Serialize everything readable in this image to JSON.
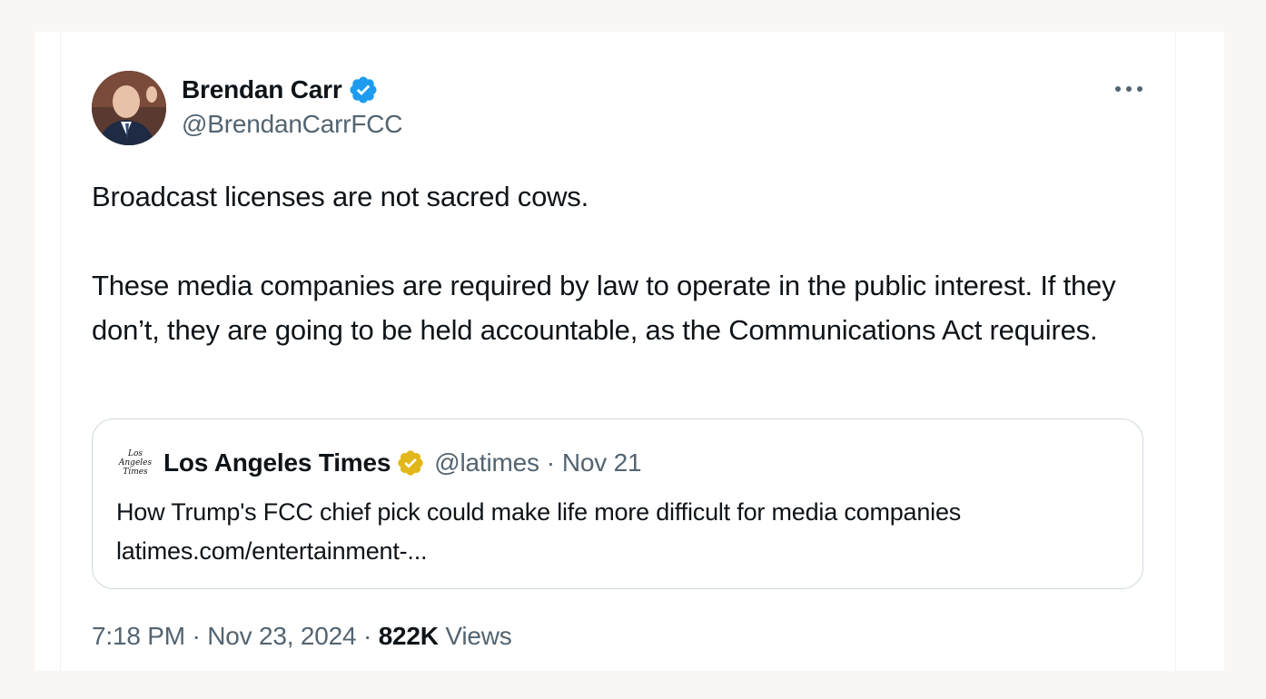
{
  "author": {
    "display_name": "Brendan Carr",
    "handle": "@BrendanCarrFCC",
    "verified_badge": "blue-check-icon",
    "avatar_icon": "profile-photo"
  },
  "more_menu_icon": "more-horizontal-icon",
  "tweet": {
    "paragraphs": [
      "Broadcast licenses are not sacred cows.",
      "These media companies are required by law to operate in the public interest. If they don’t, they are going to be held accountable, as the Communications Act requires."
    ]
  },
  "quote": {
    "logo_lines": [
      "Los",
      "Angeles",
      "Times"
    ],
    "display_name": "Los Angeles Times",
    "badge": "gold-check-icon",
    "handle": "@latimes",
    "separator": "·",
    "date": "Nov 21",
    "text": "How Trump's FCC chief pick could make life more difficult for media companies latimes.com/entertainment-..."
  },
  "meta": {
    "time": "7:18 PM",
    "separator": "·",
    "date": "Nov 23, 2024",
    "views_count": "822K",
    "views_label": "Views"
  },
  "colors": {
    "background": "#faf6f3",
    "card": "#ffffff",
    "secondary_text": "#536471",
    "verified_blue": "#1d9bf0",
    "verified_gold": "#e2b719",
    "border": "#cfd9de"
  }
}
